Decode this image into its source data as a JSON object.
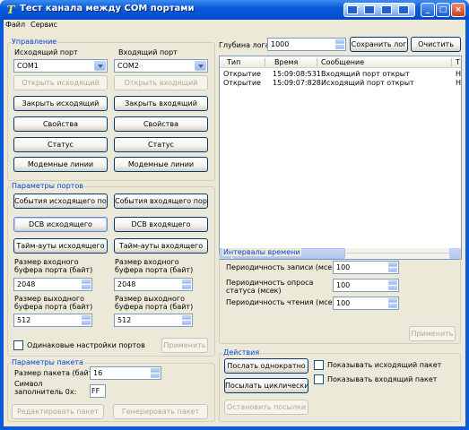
{
  "window": {
    "title": "Тест канала между COM портами"
  },
  "menu": {
    "file": "Файл",
    "service": "Сервис"
  },
  "control": {
    "title": "Управление",
    "out_port_label": "Исходящий порт",
    "in_port_label": "Входящий порт",
    "out_port_value": "COM1",
    "in_port_value": "COM2",
    "open_out": "Открыть исходящий",
    "open_in": "Открыть входящий",
    "close_out": "Закрыть исходящий",
    "close_in": "Закрыть входящий",
    "props_out": "Свойства",
    "props_in": "Свойства",
    "status_out": "Статус",
    "status_in": "Статус",
    "modem_out": "Модемные линии",
    "modem_in": "Модемные линии"
  },
  "port_params": {
    "title": "Параметры портов",
    "events_out": "События исходящего порта",
    "events_in": "События входящего порта",
    "dcb_out": "DCB исходящего",
    "dcb_in": "DCB входящего",
    "timeouts_out": "Тайм-ауты исходящего",
    "timeouts_in": "Тайм-ауты входящего",
    "in_buf_label_1": "Размер входного",
    "in_buf_label_2": "буфера порта (байт)",
    "out_in_buf_value": "2048",
    "in_in_buf_value": "2048",
    "out_buf_label_1": "Размер выходного",
    "out_buf_label_2": "буфера порта (байт)",
    "out_out_buf_value": "512",
    "in_out_buf_value": "512",
    "same_settings": "Одинаковые настройки портов",
    "apply": "Применить"
  },
  "packet": {
    "title": "Параметры пакета",
    "size_label": "Размер пакета (байт)",
    "size_value": "16",
    "fill_label_1": "Символ",
    "fill_label_2": "заполнитель 0x:",
    "fill_value": "FF",
    "edit": "Редактировать пакет",
    "generate": "Генерировать пакет"
  },
  "log": {
    "depth_label": "Глубина лога :",
    "depth_value": "1000",
    "save": "Сохранить лог",
    "clear": "Очистить",
    "columns": [
      "Тип",
      "Время",
      "Сообщение",
      "Т"
    ],
    "rows": [
      {
        "type": "Открытие",
        "time": "15:09:08:531",
        "message": "Входящий порт открыт",
        "extra": "Н"
      },
      {
        "type": "Открытие",
        "time": "15:09:07:828",
        "message": "Исходящий порт открыт",
        "extra": "Н"
      }
    ]
  },
  "intervals": {
    "title": "Интервалы времени",
    "write_label": "Периодичность записи (мсек)",
    "write_value": "100",
    "poll_label_1": "Периодичность опроса",
    "poll_label_2": "статуса (мсек)",
    "poll_value": "100",
    "read_label": "Периодичность чтения (мсек)",
    "read_value": "100",
    "apply": "Применить"
  },
  "actions": {
    "title": "Действия",
    "send_once": "Послать однократно",
    "send_cyclic": "Посылать циклически",
    "stop": "Остановить посылки",
    "show_out": "Показывать исходящий пакет",
    "show_in": "Показывать входящий пакет"
  },
  "colors": {
    "titlebar": "#0A5ADA",
    "group_title": "#0046D5",
    "window_bg": "#ECE9D8"
  }
}
